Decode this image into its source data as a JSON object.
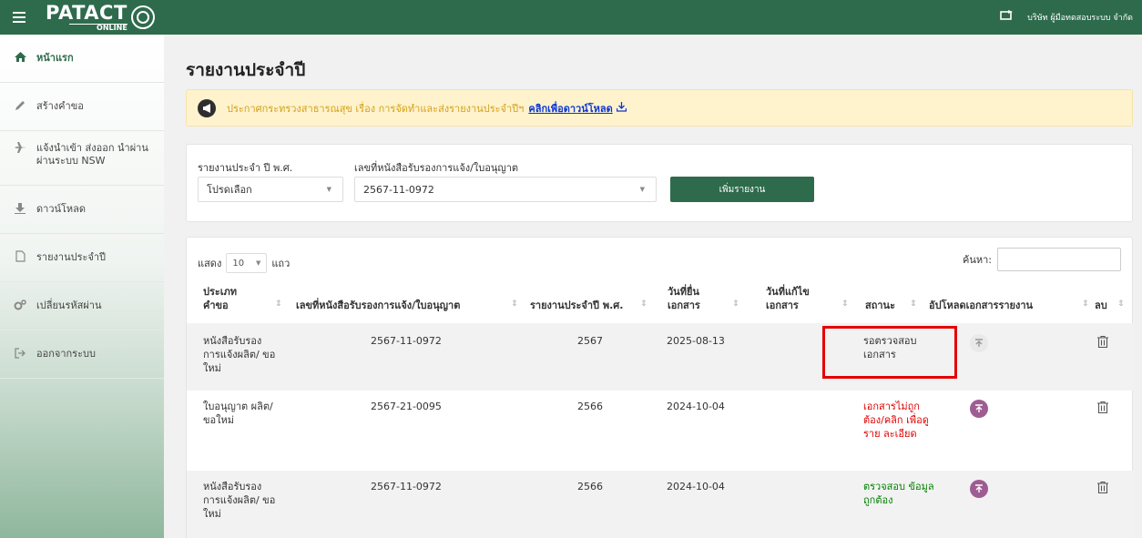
{
  "header": {
    "logo_main": "PATACT",
    "logo_sub": "ONLINE",
    "company": "บริษัท ผู้มือทดสอบระบบ จำกัด"
  },
  "sidebar": {
    "items": [
      {
        "label": "หน้าแรก",
        "icon": "home-icon"
      },
      {
        "label": "สร้างคำขอ",
        "icon": "pencil-icon"
      },
      {
        "label": "แจ้งนำเข้า ส่งออก นำผ่าน ผ่านระบบ NSW",
        "icon": "plane-icon"
      },
      {
        "label": "ดาวน์โหลด",
        "icon": "download-icon"
      },
      {
        "label": "รายงานประจำปี",
        "icon": "file-icon"
      },
      {
        "label": "เปลี่ยนรหัสผ่าน",
        "icon": "gears-icon"
      },
      {
        "label": "ออกจากระบบ",
        "icon": "sign-out-icon"
      }
    ]
  },
  "main": {
    "title": "รายงานประจำปี",
    "announcement": {
      "text": "ประกาศกระทรวงสาธารณสุข เรื่อง การจัดทำและส่งรายงานประจำปีฯ",
      "link": "คลิกเพื่อดาวน์โหลด"
    },
    "form": {
      "year_label": "รายงานประจำ ปี พ.ศ.",
      "year_value": "โปรดเลือก",
      "license_label": "เลขที่หนังสือรับรองการแจ้ง/ใบอนุญาต",
      "license_value": "2567-11-0972",
      "add_button": "เพิ่มรายงาน"
    },
    "table": {
      "show_label": "แสดง",
      "page_length": "10",
      "rows_label": "แถว",
      "search_label": "ค้นหา:",
      "search_value": "",
      "columns": {
        "type": "ประเภท คำขอ",
        "license": "เลขที่หนังสือรับรองการแจ้ง/ใบอนุญาต",
        "year": "รายงานประจำปี พ.ศ.",
        "submitted": "วันที่ยื่น เอกสาร",
        "edited": "วันที่แก้ไข เอกสาร",
        "status": "สถานะ",
        "upload": "อัปโหลดเอกสารรายงาน",
        "delete": "ลบ"
      },
      "rows": [
        {
          "type": "หนังสือรับรอง การแจ้งผลิต/ ขอใหม่",
          "license": "2567-11-0972",
          "year": "2567",
          "submitted": "2025-08-13",
          "edited": "",
          "status": "รอตรวจสอบ เอกสาร",
          "status_color": "#333333",
          "upload_enabled": false
        },
        {
          "type": "ใบอนุญาต ผลิต/ขอใหม่",
          "license": "2567-21-0095",
          "year": "2566",
          "submitted": "2024-10-04",
          "edited": "",
          "status": "เอกสารไม่ถูก ต้อง/คลิก เพื่อดูราย ละเอียด",
          "status_color": "#e00000",
          "upload_enabled": true
        },
        {
          "type": "หนังสือรับรอง การแจ้งผลิต/ ขอใหม่",
          "license": "2567-11-0972",
          "year": "2566",
          "submitted": "2024-10-04",
          "edited": "",
          "status": "ตรวจสอบ ข้อมูลถูกต้อง",
          "status_color": "#008000",
          "upload_enabled": true
        }
      ]
    }
  },
  "colors": {
    "brand_green": "#2e6b4c",
    "alert_bg": "#fff3cd",
    "alert_text": "#d4a017",
    "link_blue": "#0b36d6",
    "upload_purple": "#9e5c92",
    "highlight_red": "#e30000"
  }
}
